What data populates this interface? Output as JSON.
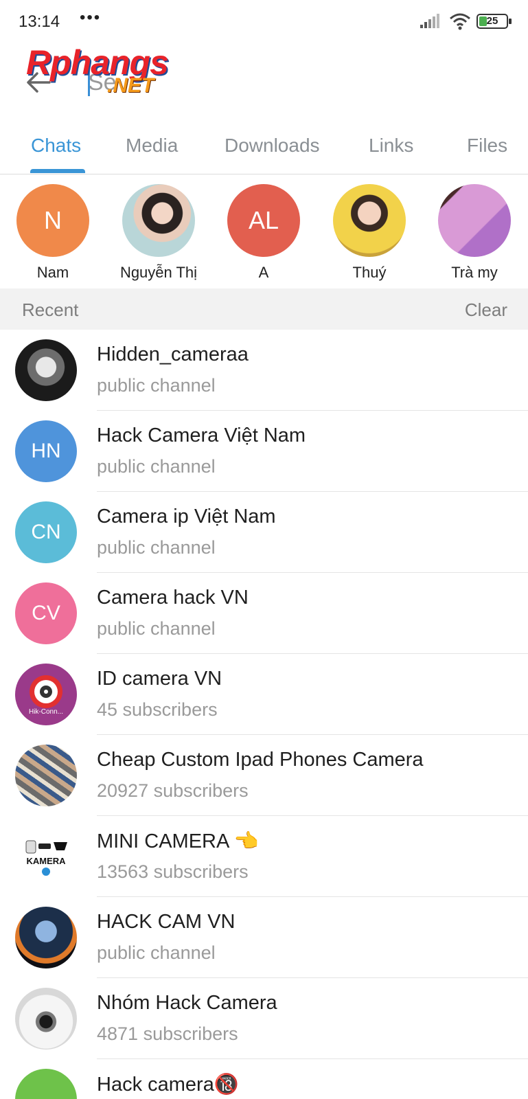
{
  "status_bar": {
    "time": "13:14",
    "dots": "•••",
    "battery_level": "25",
    "signal_icon": "signal-icon",
    "wifi_icon": "wifi-icon"
  },
  "header": {
    "search_value": "Se",
    "search_placeholder_tail": "n",
    "logo_text": "Rphangs",
    "logo_suffix": ".NET"
  },
  "tabs": [
    {
      "label": "Chats",
      "active": true
    },
    {
      "label": "Media",
      "active": false
    },
    {
      "label": "Downloads",
      "active": false
    },
    {
      "label": "Links",
      "active": false
    },
    {
      "label": "Files",
      "active": false
    }
  ],
  "people": [
    {
      "initials": "N",
      "name": "Nam",
      "color": "#f0894a",
      "photo": false
    },
    {
      "initials": "",
      "name": "Nguyễn Thị",
      "color": "#c9b7a8",
      "photo": true
    },
    {
      "initials": "AL",
      "name": "A",
      "color": "#e25f4f",
      "photo": false
    },
    {
      "initials": "",
      "name": "Thuý",
      "color": "#d8b04a",
      "photo": true
    },
    {
      "initials": "",
      "name": "Trà my",
      "color": "#c88bd0",
      "photo": true
    }
  ],
  "recent": {
    "label": "Recent",
    "clear_label": "Clear"
  },
  "chats": [
    {
      "title": "Hidden_cameraa",
      "subtitle": "public channel",
      "initials": "",
      "color": "#2b2b2b",
      "photo": true
    },
    {
      "title": "Hack Camera Việt Nam",
      "subtitle": "public channel",
      "initials": "HN",
      "color": "#4f94db",
      "photo": false
    },
    {
      "title": "Camera ip Việt Nam",
      "subtitle": "public channel",
      "initials": "CN",
      "color": "#5bbcd8",
      "photo": false
    },
    {
      "title": "Camera hack VN",
      "subtitle": "public channel",
      "initials": "CV",
      "color": "#ef6f9a",
      "photo": false
    },
    {
      "title": "ID camera VN",
      "subtitle": "45 subscribers",
      "initials": "",
      "color": "#9a3a8a",
      "photo": true,
      "photo_text": "Hik-Conn..."
    },
    {
      "title": "Cheap Custom Ipad Phones Camera",
      "subtitle": "20927 subscribers",
      "initials": "",
      "color": "#8a7a6a",
      "photo": true
    },
    {
      "title": "MINI CAMERA 👈",
      "subtitle": "13563 subscribers",
      "initials": "",
      "color": "#ffffff",
      "photo": true,
      "photo_text": "KAMERA"
    },
    {
      "title": "HACK CAM VN",
      "subtitle": "public channel",
      "initials": "",
      "color": "#2a3a55",
      "photo": true
    },
    {
      "title": "Nhóm Hack Camera",
      "subtitle": "4871 subscribers",
      "initials": "",
      "color": "#e8e8e8",
      "photo": true
    },
    {
      "title": "Hack camera🔞",
      "subtitle": "",
      "initials": "",
      "color": "#6ec24a",
      "photo": false
    }
  ]
}
